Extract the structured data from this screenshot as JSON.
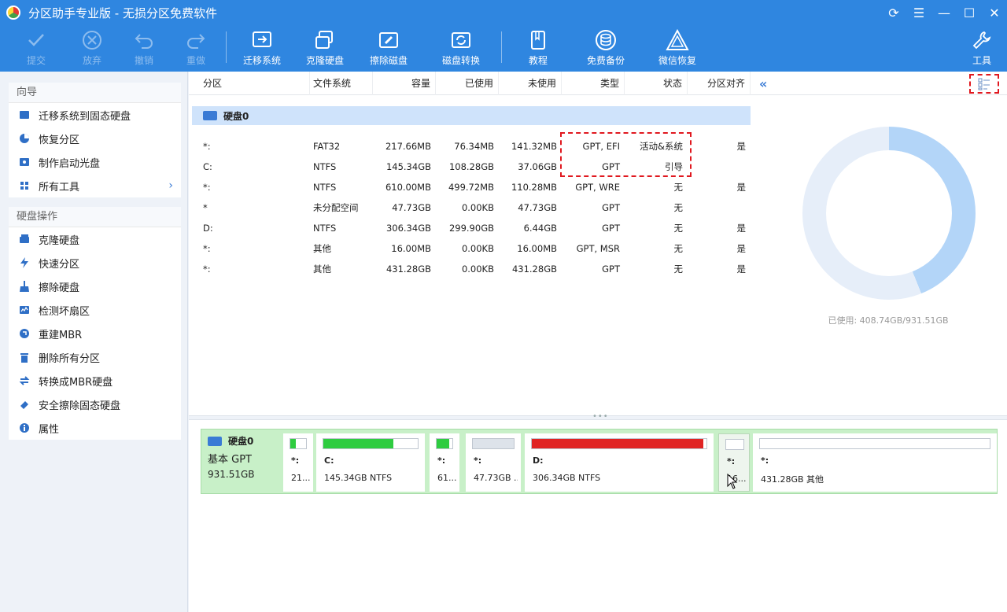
{
  "app": {
    "title": "分区助手专业版 - 无损分区免费软件"
  },
  "toolbar": {
    "commit": "提交",
    "discard": "放弃",
    "undo": "撤销",
    "redo": "重做",
    "migrate": "迁移系统",
    "clone": "克隆硬盘",
    "wipe": "擦除磁盘",
    "convert": "磁盘转换",
    "tutorial": "教程",
    "backup": "免费备份",
    "wechat": "微信恢复",
    "tools": "工具"
  },
  "sidebar": {
    "wizard_title": "向导",
    "wizard_items": [
      "迁移系统到固态硬盘",
      "恢复分区",
      "制作启动光盘",
      "所有工具"
    ],
    "disk_ops_title": "硬盘操作",
    "disk_ops_items": [
      "克隆硬盘",
      "快速分区",
      "擦除硬盘",
      "检测坏扇区",
      "重建MBR",
      "删除所有分区",
      "转换成MBR硬盘",
      "安全擦除固态硬盘",
      "属性"
    ]
  },
  "columns": {
    "partition": "分区",
    "fs": "文件系统",
    "capacity": "容量",
    "used": "已使用",
    "free": "未使用",
    "type": "类型",
    "status": "状态",
    "align": "分区对齐",
    "toggle": "«"
  },
  "disk": {
    "name": "硬盘0",
    "kind": "基本 GPT",
    "size": "931.51GB",
    "usage_label": "已使用: 408.74GB/931.51GB",
    "used_fraction": 0.439
  },
  "partitions": [
    {
      "part": "*:",
      "fs": "FAT32",
      "cap": "217.66MB",
      "used": "76.34MB",
      "free": "141.32MB",
      "type": "GPT, EFI",
      "status": "活动&系统",
      "align": "是"
    },
    {
      "part": "C:",
      "fs": "NTFS",
      "cap": "145.34GB",
      "used": "108.28GB",
      "free": "37.06GB",
      "type": "GPT",
      "status": "引导",
      "align": ""
    },
    {
      "part": "*:",
      "fs": "NTFS",
      "cap": "610.00MB",
      "used": "499.72MB",
      "free": "110.28MB",
      "type": "GPT, WRE",
      "status": "无",
      "align": "是"
    },
    {
      "part": "*",
      "fs": "未分配空间",
      "cap": "47.73GB",
      "used": "0.00KB",
      "free": "47.73GB",
      "type": "GPT",
      "status": "无",
      "align": ""
    },
    {
      "part": "D:",
      "fs": "NTFS",
      "cap": "306.34GB",
      "used": "299.90GB",
      "free": "6.44GB",
      "type": "GPT",
      "status": "无",
      "align": "是"
    },
    {
      "part": "*:",
      "fs": "其他",
      "cap": "16.00MB",
      "used": "0.00KB",
      "free": "16.00MB",
      "type": "GPT, MSR",
      "status": "无",
      "align": "是"
    },
    {
      "part": "*:",
      "fs": "其他",
      "cap": "431.28GB",
      "used": "0.00KB",
      "free": "431.28GB",
      "type": "GPT",
      "status": "无",
      "align": "是"
    }
  ],
  "diskmap": [
    {
      "name": "*:",
      "desc": "21...",
      "fill": 0.35,
      "color": "#2ecc40"
    },
    {
      "name": "C:",
      "desc": "145.34GB NTFS",
      "fill": 0.745,
      "color": "#2ecc40"
    },
    {
      "name": "*:",
      "desc": "61...",
      "fill": 0.82,
      "color": "#2ecc40"
    },
    {
      "name": "*:",
      "desc": "47.73GB ...",
      "fill": 0,
      "color": "#dde3ea"
    },
    {
      "name": "D:",
      "desc": "306.34GB NTFS",
      "fill": 0.98,
      "color": "#e02424"
    },
    {
      "name": "*:",
      "desc": "16...",
      "fill": 0,
      "color": "#ffffff"
    },
    {
      "name": "*:",
      "desc": "431.28GB 其他",
      "fill": 0,
      "color": "#ffffff"
    }
  ],
  "colors": {
    "brand": "#2f86e0",
    "accent": "#3a7bd5",
    "alert": "#e0181f"
  }
}
